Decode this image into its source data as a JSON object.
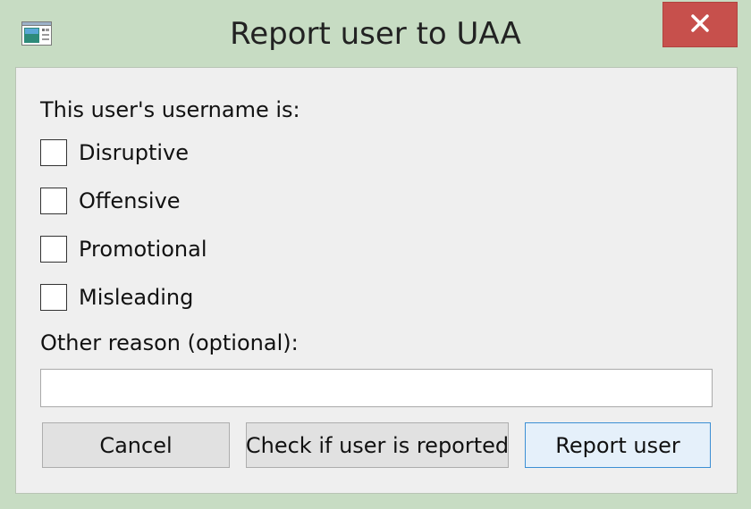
{
  "window": {
    "title": "Report user to UAA",
    "app_icon": "application-window-icon",
    "close_icon": "close-x-icon",
    "colors": {
      "frame": "#c7dcc3",
      "close_button": "#c7504c",
      "client_background": "#efefef",
      "default_button_border": "#3c8fd4"
    }
  },
  "form": {
    "username_prompt": "This user's username is:",
    "options": [
      {
        "label": "Disruptive",
        "checked": false
      },
      {
        "label": "Offensive",
        "checked": false
      },
      {
        "label": "Promotional",
        "checked": false
      },
      {
        "label": "Misleading",
        "checked": false
      }
    ],
    "other_reason_label": "Other reason (optional):",
    "other_reason_value": ""
  },
  "buttons": {
    "cancel": "Cancel",
    "check": "Check if user is reported",
    "report": "Report user"
  }
}
